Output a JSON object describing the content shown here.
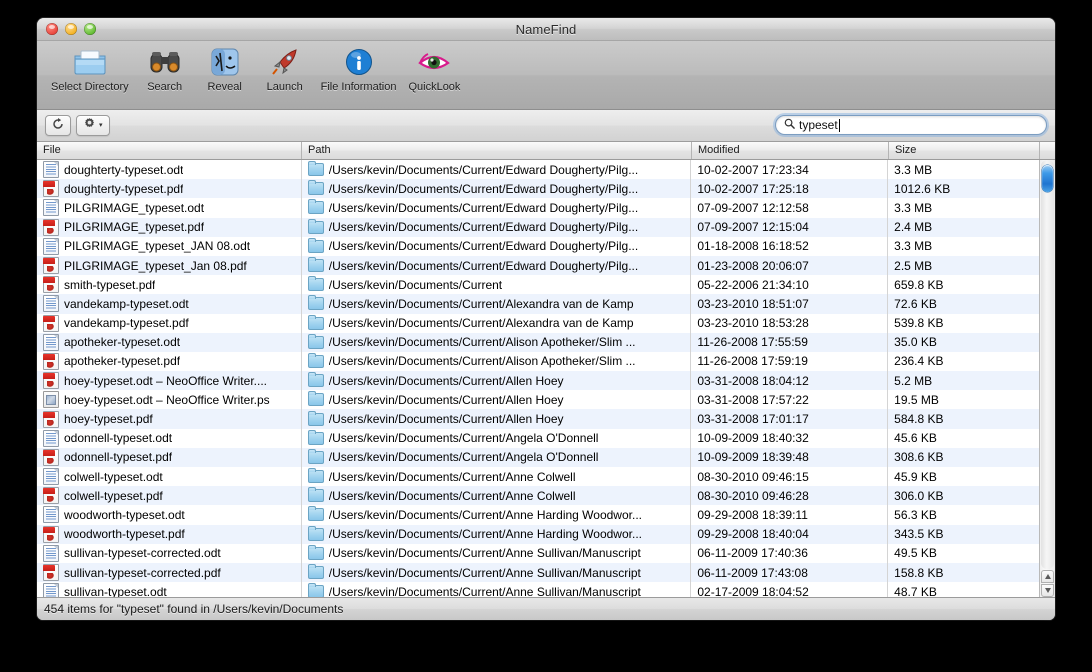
{
  "window": {
    "title": "NameFind",
    "controls": {
      "close": "close-button",
      "minimize": "minimize-button",
      "zoom": "zoom-button"
    }
  },
  "toolbar": {
    "items": [
      {
        "label": "Select Directory",
        "icon": "folder-icon"
      },
      {
        "label": "Search",
        "icon": "binoculars-icon"
      },
      {
        "label": "Reveal",
        "icon": "finder-face-icon"
      },
      {
        "label": "Launch",
        "icon": "rocket-icon"
      },
      {
        "label": "File Information",
        "icon": "info-circle-icon"
      },
      {
        "label": "QuickLook",
        "icon": "eye-icon"
      }
    ]
  },
  "secondbar": {
    "refresh_icon": "refresh-icon",
    "gear_icon": "gear-icon",
    "gear_disclosure": "▾"
  },
  "search": {
    "icon": "search-icon",
    "value": "typeset",
    "placeholder": ""
  },
  "columns": [
    {
      "key": "file",
      "label": "File"
    },
    {
      "key": "path",
      "label": "Path"
    },
    {
      "key": "modified",
      "label": "Modified"
    },
    {
      "key": "size",
      "label": "Size"
    }
  ],
  "rows": [
    {
      "icon": "odt",
      "file": "doughterty-typeset.odt",
      "path": "/Users/kevin/Documents/Current/Edward Dougherty/Pilg...",
      "modified": "10-02-2007 17:23:34",
      "size": "3.3 MB"
    },
    {
      "icon": "pdf",
      "file": "doughterty-typeset.pdf",
      "path": "/Users/kevin/Documents/Current/Edward Dougherty/Pilg...",
      "modified": "10-02-2007 17:25:18",
      "size": "1012.6 KB"
    },
    {
      "icon": "odt",
      "file": "PILGRIMAGE_typeset.odt",
      "path": "/Users/kevin/Documents/Current/Edward Dougherty/Pilg...",
      "modified": "07-09-2007 12:12:58",
      "size": "3.3 MB"
    },
    {
      "icon": "pdf",
      "file": "PILGRIMAGE_typeset.pdf",
      "path": "/Users/kevin/Documents/Current/Edward Dougherty/Pilg...",
      "modified": "07-09-2007 12:15:04",
      "size": "2.4 MB"
    },
    {
      "icon": "odt",
      "file": "PILGRIMAGE_typeset_JAN 08.odt",
      "path": "/Users/kevin/Documents/Current/Edward Dougherty/Pilg...",
      "modified": "01-18-2008 16:18:52",
      "size": "3.3 MB"
    },
    {
      "icon": "pdf",
      "file": "PILGRIMAGE_typeset_Jan 08.pdf",
      "path": "/Users/kevin/Documents/Current/Edward Dougherty/Pilg...",
      "modified": "01-23-2008 20:06:07",
      "size": "2.5 MB"
    },
    {
      "icon": "pdf",
      "file": "smith-typeset.pdf",
      "path": "/Users/kevin/Documents/Current",
      "modified": "05-22-2006 21:34:10",
      "size": "659.8 KB"
    },
    {
      "icon": "odt",
      "file": "vandekamp-typeset.odt",
      "path": "/Users/kevin/Documents/Current/Alexandra van de Kamp",
      "modified": "03-23-2010 18:51:07",
      "size": "72.6 KB"
    },
    {
      "icon": "pdf",
      "file": "vandekamp-typeset.pdf",
      "path": "/Users/kevin/Documents/Current/Alexandra van de Kamp",
      "modified": "03-23-2010 18:53:28",
      "size": "539.8 KB"
    },
    {
      "icon": "odt",
      "file": "apotheker-typeset.odt",
      "path": "/Users/kevin/Documents/Current/Alison Apotheker/Slim ...",
      "modified": "11-26-2008 17:55:59",
      "size": "35.0 KB"
    },
    {
      "icon": "pdf",
      "file": "apotheker-typeset.pdf",
      "path": "/Users/kevin/Documents/Current/Alison Apotheker/Slim ...",
      "modified": "11-26-2008 17:59:19",
      "size": "236.4 KB"
    },
    {
      "icon": "pdf",
      "file": "hoey-typeset.odt – NeoOffice Writer....",
      "path": "/Users/kevin/Documents/Current/Allen Hoey",
      "modified": "03-31-2008 18:04:12",
      "size": "5.2 MB"
    },
    {
      "icon": "ps",
      "file": "hoey-typeset.odt – NeoOffice Writer.ps",
      "path": "/Users/kevin/Documents/Current/Allen Hoey",
      "modified": "03-31-2008 17:57:22",
      "size": "19.5 MB"
    },
    {
      "icon": "pdf",
      "file": "hoey-typeset.pdf",
      "path": "/Users/kevin/Documents/Current/Allen Hoey",
      "modified": "03-31-2008 17:01:17",
      "size": "584.8 KB"
    },
    {
      "icon": "odt",
      "file": "odonnell-typeset.odt",
      "path": "/Users/kevin/Documents/Current/Angela O'Donnell",
      "modified": "10-09-2009 18:40:32",
      "size": "45.6 KB"
    },
    {
      "icon": "pdf",
      "file": "odonnell-typeset.pdf",
      "path": "/Users/kevin/Documents/Current/Angela O'Donnell",
      "modified": "10-09-2009 18:39:48",
      "size": "308.6 KB"
    },
    {
      "icon": "odt",
      "file": "colwell-typeset.odt",
      "path": "/Users/kevin/Documents/Current/Anne Colwell",
      "modified": "08-30-2010 09:46:15",
      "size": "45.9 KB"
    },
    {
      "icon": "pdf",
      "file": "colwell-typeset.pdf",
      "path": "/Users/kevin/Documents/Current/Anne Colwell",
      "modified": "08-30-2010 09:46:28",
      "size": "306.0 KB"
    },
    {
      "icon": "odt",
      "file": "woodworth-typeset.odt",
      "path": "/Users/kevin/Documents/Current/Anne Harding Woodwor...",
      "modified": "09-29-2008 18:39:11",
      "size": "56.3 KB"
    },
    {
      "icon": "pdf",
      "file": "woodworth-typeset.pdf",
      "path": "/Users/kevin/Documents/Current/Anne Harding Woodwor...",
      "modified": "09-29-2008 18:40:04",
      "size": "343.5 KB"
    },
    {
      "icon": "odt",
      "file": "sullivan-typeset-corrected.odt",
      "path": "/Users/kevin/Documents/Current/Anne Sullivan/Manuscript",
      "modified": "06-11-2009 17:40:36",
      "size": "49.5 KB"
    },
    {
      "icon": "pdf",
      "file": "sullivan-typeset-corrected.pdf",
      "path": "/Users/kevin/Documents/Current/Anne Sullivan/Manuscript",
      "modified": "06-11-2009 17:43:08",
      "size": "158.8 KB"
    },
    {
      "icon": "odt",
      "file": "sullivan-typeset.odt",
      "path": "/Users/kevin/Documents/Current/Anne Sullivan/Manuscript",
      "modified": "02-17-2009 18:04:52",
      "size": "48.7 KB"
    }
  ],
  "scrollbar": {
    "up_arrow": "▲",
    "down_arrow": "▼"
  },
  "statusbar": {
    "text": "454 items for \"typeset\" found in /Users/kevin/Documents"
  }
}
